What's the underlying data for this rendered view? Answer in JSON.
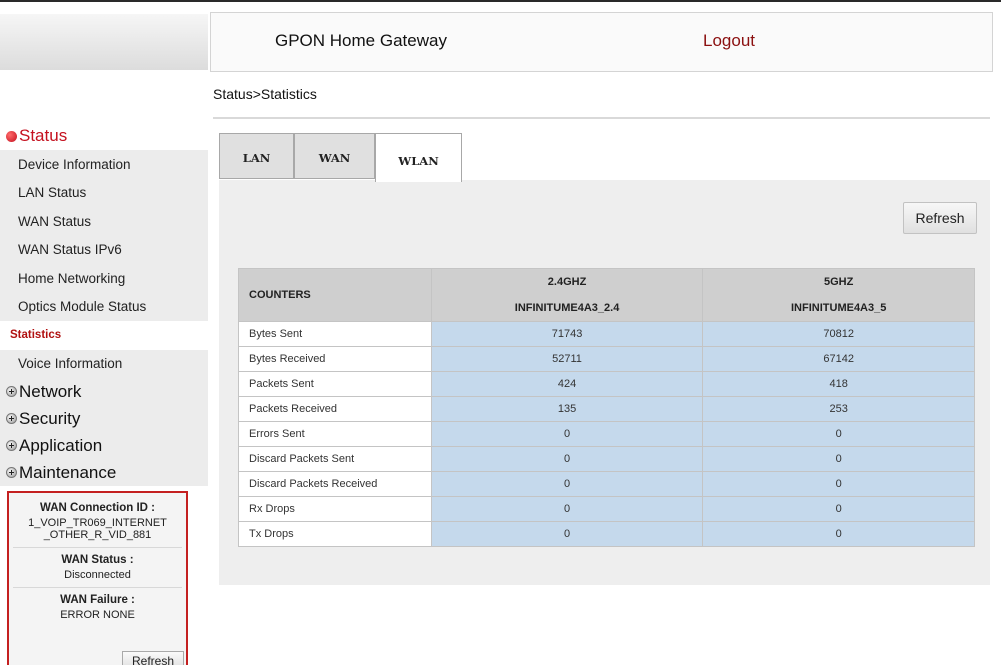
{
  "header": {
    "title": "GPON Home Gateway",
    "logout": "Logout"
  },
  "breadcrumb": "Status>Statistics",
  "sidebar": {
    "status_group": "Status",
    "status_items": [
      "Device Information",
      "LAN Status",
      "WAN Status",
      "WAN Status IPv6",
      "Home Networking",
      "Optics Module Status",
      "Statistics",
      "Voice Information"
    ],
    "selected_item": "Statistics",
    "groups": [
      "Network",
      "Security",
      "Application",
      "Maintenance"
    ]
  },
  "status_panel": {
    "conn_label": "WAN Connection ID :",
    "conn_value_1": "1_VOIP_TR069_INTERNET",
    "conn_value_2": "_OTHER_R_VID_881",
    "wan_status_label": "WAN Status :",
    "wan_status_value": "Disconnected",
    "wan_failure_label": "WAN Failure :",
    "wan_failure_value": "ERROR NONE",
    "refresh": "Refresh"
  },
  "tabs": [
    "LAN",
    "WAN",
    "WLAN"
  ],
  "active_tab": "WLAN",
  "refresh_label": "Refresh",
  "table": {
    "counters_header": "COUNTERS",
    "columns": [
      {
        "band": "2.4GHZ",
        "ssid": "INFINITUME4A3_2.4"
      },
      {
        "band": "5GHZ",
        "ssid": "INFINITUME4A3_5"
      }
    ],
    "rows": [
      {
        "label": "Bytes Sent",
        "v24": "71743",
        "v5": "70812"
      },
      {
        "label": "Bytes Received",
        "v24": "52711",
        "v5": "67142"
      },
      {
        "label": "Packets Sent",
        "v24": "424",
        "v5": "418"
      },
      {
        "label": "Packets Received",
        "v24": "135",
        "v5": "253"
      },
      {
        "label": "Errors Sent",
        "v24": "0",
        "v5": "0"
      },
      {
        "label": "Discard Packets Sent",
        "v24": "0",
        "v5": "0"
      },
      {
        "label": "Discard Packets Received",
        "v24": "0",
        "v5": "0"
      },
      {
        "label": "Rx Drops",
        "v24": "0",
        "v5": "0"
      },
      {
        "label": "Tx Drops",
        "v24": "0",
        "v5": "0"
      }
    ]
  },
  "colors": {
    "accent_red": "#c4101e",
    "logout_red": "#8b1010",
    "value_cell_blue": "#c5d9ec",
    "header_gray": "#cfcfcf",
    "panel_gray": "#eeeeee"
  }
}
